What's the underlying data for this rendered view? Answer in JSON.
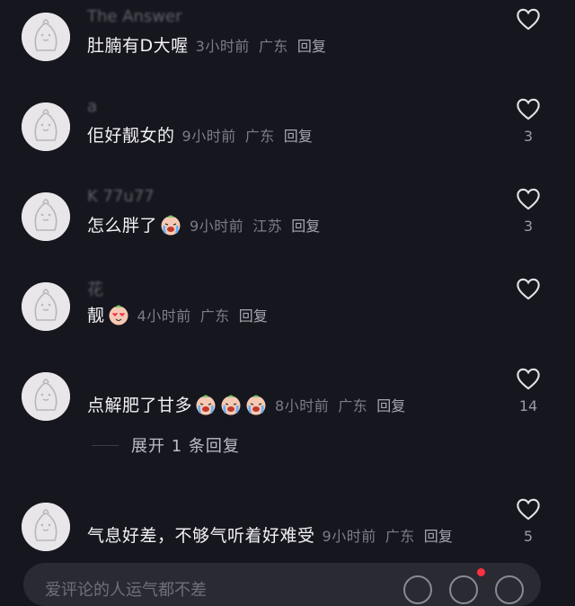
{
  "comments": [
    {
      "username": "The Answer",
      "text": "肚腩有D大喔",
      "emojis": [],
      "time": "3小时前",
      "location": "广东",
      "reply": "回复",
      "likes": ""
    },
    {
      "username": "a",
      "text": "佢好靓女的",
      "emojis": [],
      "time": "9小时前",
      "location": "广东",
      "reply": "回复",
      "likes": "3"
    },
    {
      "username": "K 77u77",
      "text": "怎么胖了",
      "emojis": [
        "crying-face"
      ],
      "time": "9小时前",
      "location": "江苏",
      "reply": "回复",
      "likes": "3"
    },
    {
      "username": "花",
      "text": "靓",
      "emojis": [
        "heart-eyes-face"
      ],
      "time": "4小时前",
      "location": "广东",
      "reply": "回复",
      "likes": ""
    },
    {
      "username": "",
      "text": "点解肥了甘多",
      "emojis": [
        "crying-face",
        "crying-face",
        "crying-face"
      ],
      "time": "8小时前",
      "location": "广东",
      "reply": "回复",
      "likes": "14"
    },
    {
      "username": "",
      "text": "气息好差，不够气听着好难受",
      "emojis": [],
      "time": "9小时前",
      "location": "广东",
      "reply": "回复",
      "likes": "5"
    }
  ],
  "expand_replies": "展开 1 条回复",
  "input": {
    "placeholder": "爱评论的人运气都不差"
  },
  "colors": {
    "background": "#16161e",
    "notification_dot": "#ff3040"
  }
}
